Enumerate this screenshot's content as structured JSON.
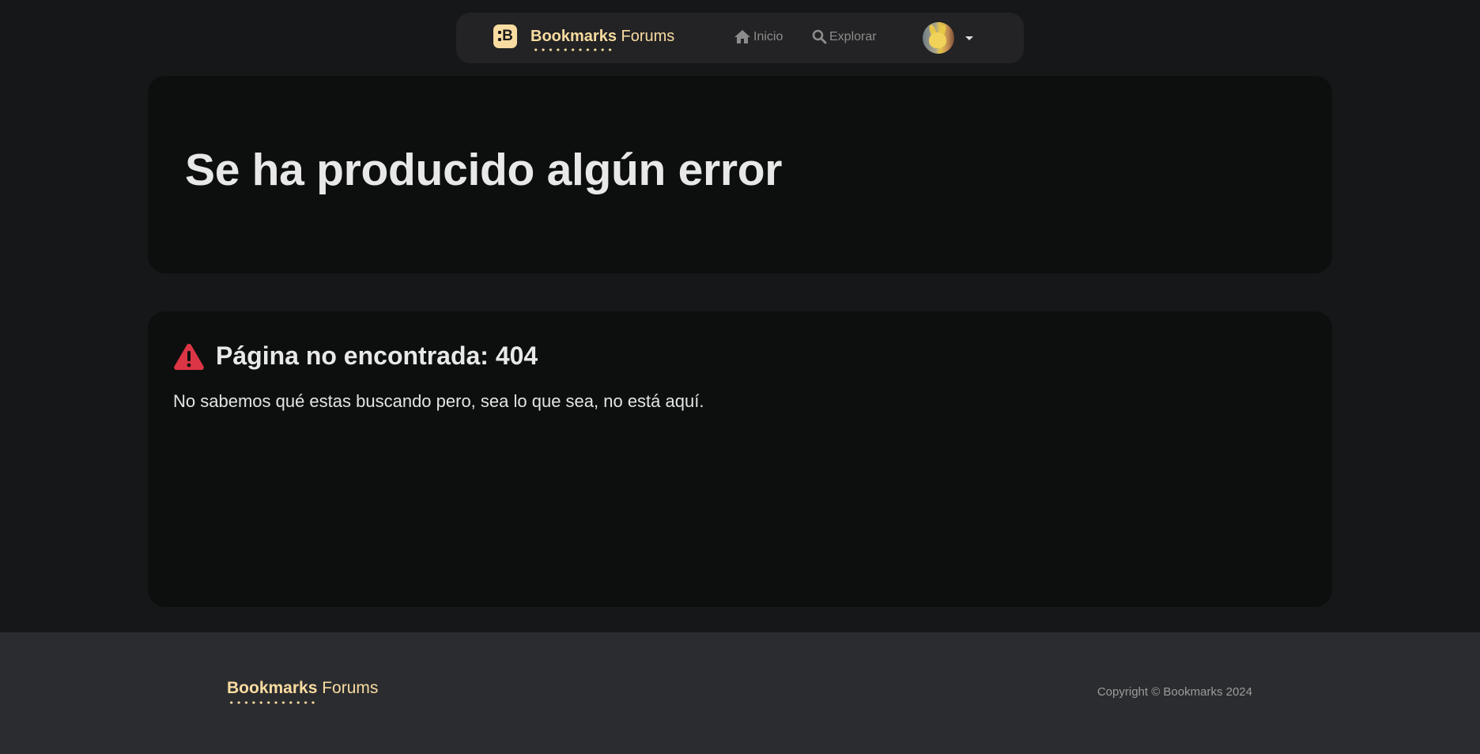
{
  "nav": {
    "brand_strong": "Bookmarks",
    "brand_light": "Forums",
    "logo_letter": "B",
    "links": [
      {
        "label": "Inicio",
        "icon": "home-icon"
      },
      {
        "label": "Explorar",
        "icon": "search-icon"
      }
    ],
    "avatar_icon": "user-avatar",
    "dropdown_icon": "caret-down-icon"
  },
  "hero": {
    "title": "Se ha producido algún error"
  },
  "error": {
    "icon": "warning-triangle-icon",
    "title": "Página no encontrada: 404",
    "message": "No sabemos qué estas buscando pero, sea lo que sea, no está aquí."
  },
  "footer": {
    "brand_strong": "Bookmarks",
    "brand_light": "Forums",
    "copyright": "Copyright © Bookmarks 2024"
  },
  "colors": {
    "background": "#161718",
    "card": "#0d0f0f",
    "navbar": "#232325",
    "footer": "#2b2c30",
    "accent": "#f9dca0",
    "warning": "#dc3545",
    "nav_link": "#8c8c8c"
  }
}
